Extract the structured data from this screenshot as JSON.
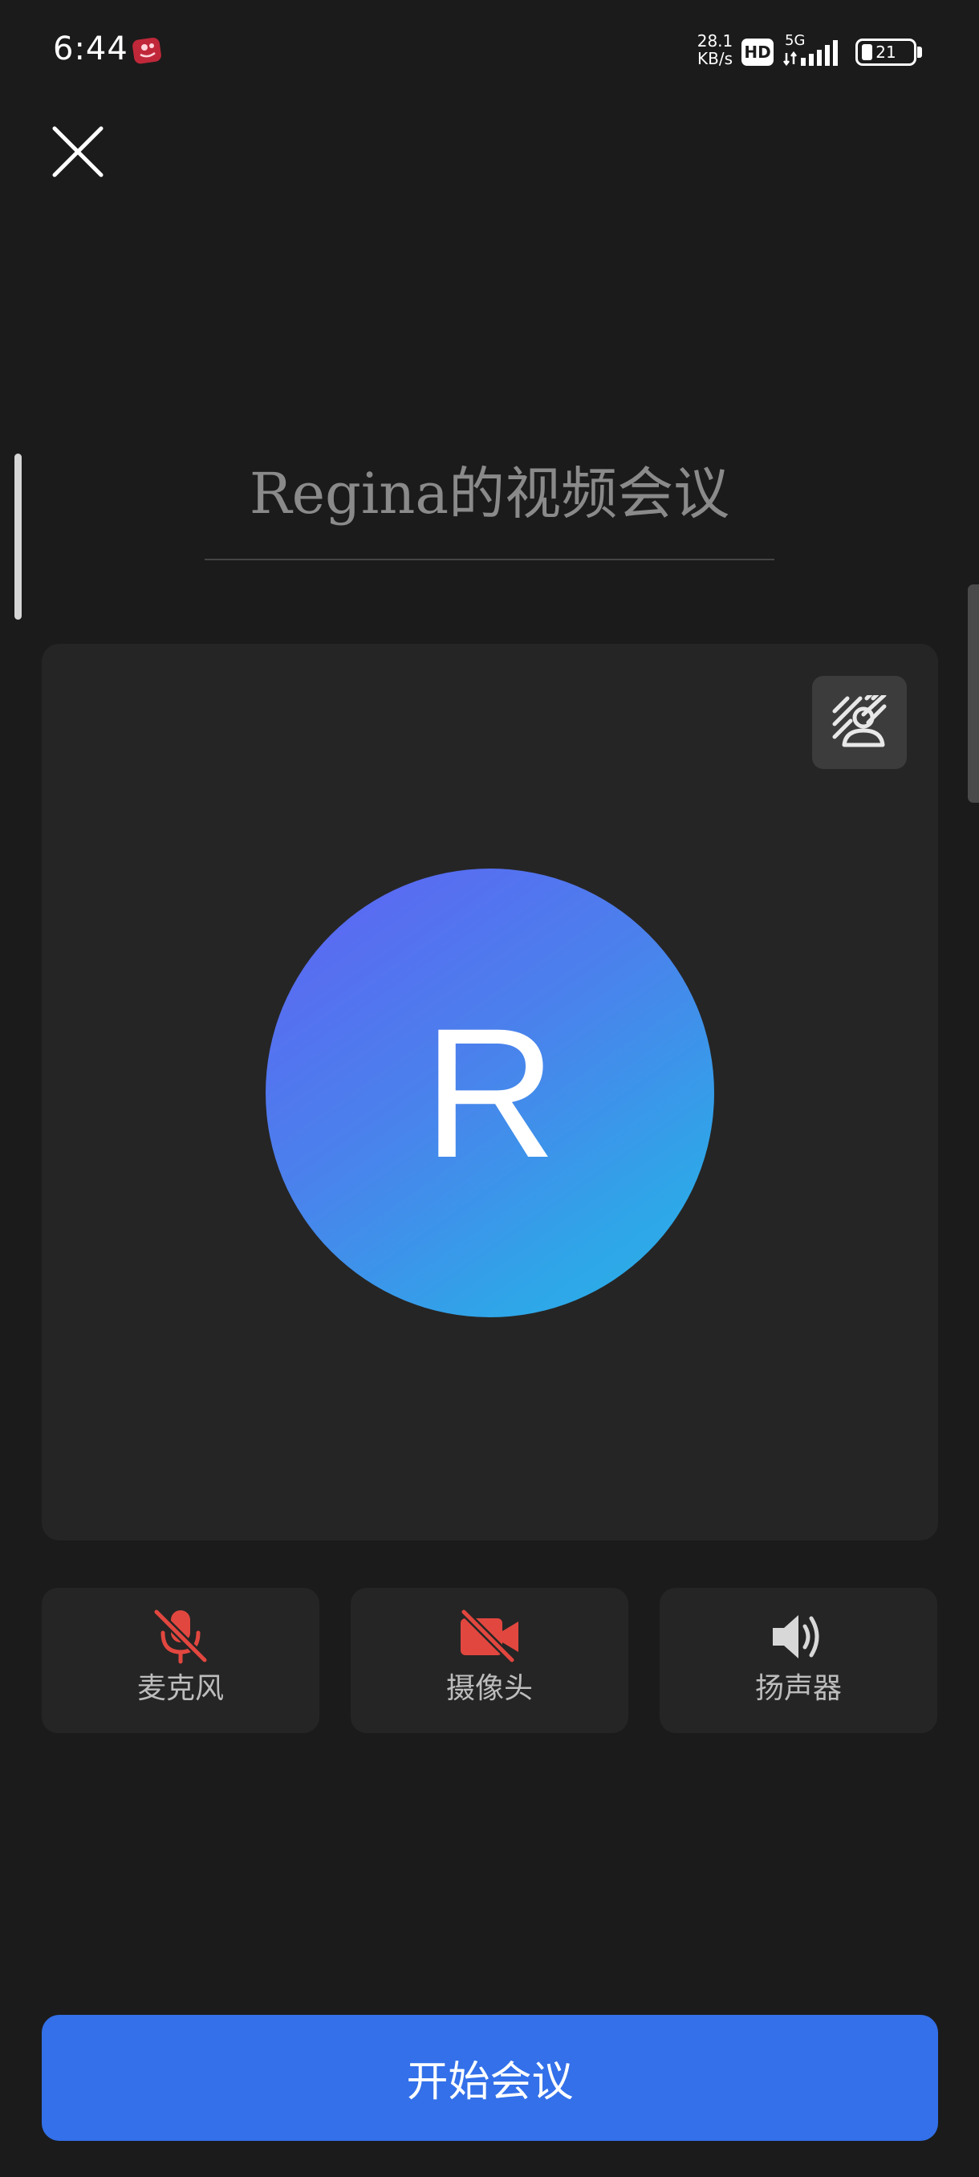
{
  "status_bar": {
    "time": "6:44",
    "net_speed_value": "28.1",
    "net_speed_unit": "KB/s",
    "hd_label": "HD",
    "network_type": "5G",
    "battery_level": "21"
  },
  "meeting": {
    "title": "Regina的视频会议"
  },
  "preview": {
    "avatar_initial": "R",
    "avatar_gradient": [
      "#5f62f4",
      "#28b2e8"
    ]
  },
  "controls": {
    "microphone": {
      "label": "麦克风",
      "icon": "mic-off-icon",
      "state": "off",
      "color": "#e2473f"
    },
    "camera": {
      "label": "摄像头",
      "icon": "camera-off-icon",
      "state": "off",
      "color": "#e2473f"
    },
    "speaker": {
      "label": "扬声器",
      "icon": "speaker-icon",
      "state": "on",
      "color": "#d8d8d8"
    }
  },
  "start_button": {
    "label": "开始会议",
    "color": "#3370e9"
  }
}
